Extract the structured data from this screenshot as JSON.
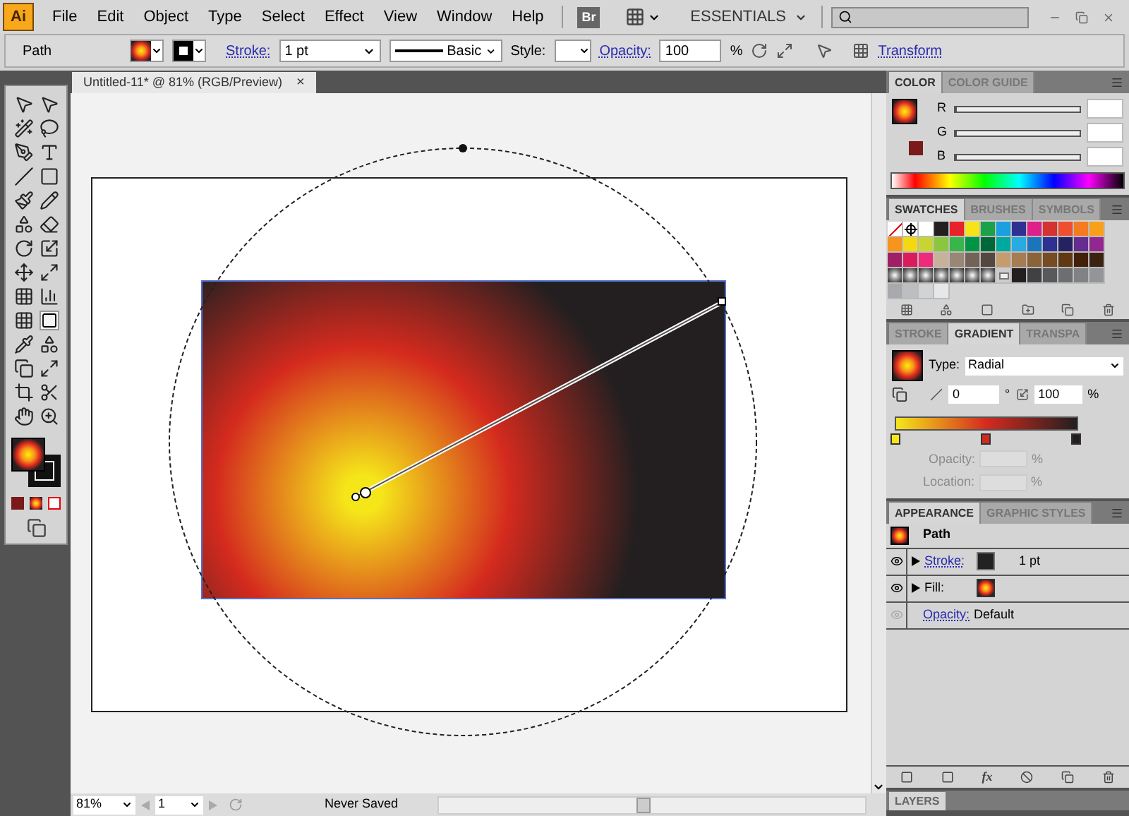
{
  "app_logo": "Ai",
  "menu": [
    "File",
    "Edit",
    "Object",
    "Type",
    "Select",
    "Effect",
    "View",
    "Window",
    "Help"
  ],
  "bridge_button": "Br",
  "workspace": "ESSENTIALS",
  "control_bar": {
    "selection": "Path",
    "stroke_label": "Stroke:",
    "stroke_weight": "1 pt",
    "brush": "Basic",
    "style_label": "Style:",
    "opacity_label": "Opacity:",
    "opacity_value": "100",
    "opacity_unit": "%",
    "transform_link": "Transform"
  },
  "document_tab": {
    "title": "Untitled-11* @ 81% (RGB/Preview)",
    "close": "×"
  },
  "color_panel": {
    "tabs": [
      {
        "label": "COLOR",
        "selected": true
      },
      {
        "label": "COLOR GUIDE",
        "selected": false
      }
    ],
    "channels": [
      {
        "label": "R",
        "level": 0
      },
      {
        "label": "G",
        "level": 0
      },
      {
        "label": "B",
        "level": 0
      }
    ]
  },
  "swatches_panel": {
    "tabs": [
      {
        "label": "SWATCHES",
        "selected": true
      },
      {
        "label": "BRUSHES",
        "selected": false
      },
      {
        "label": "SYMBOLS",
        "selected": false
      }
    ],
    "swatches": [
      {
        "kind": "none"
      },
      {
        "kind": "registration"
      },
      {
        "kind": "solid",
        "color": "#ffffff"
      },
      {
        "kind": "solid",
        "color": "#231f20"
      },
      {
        "kind": "solid",
        "color": "#e8222a"
      },
      {
        "kind": "solid",
        "color": "#f7e417"
      },
      {
        "kind": "solid",
        "color": "#1aa14a"
      },
      {
        "kind": "solid",
        "color": "#1a9fe0"
      },
      {
        "kind": "solid",
        "color": "#2e3192"
      },
      {
        "kind": "solid",
        "color": "#e0208a"
      },
      {
        "kind": "solid",
        "color": "#d4332f"
      },
      {
        "kind": "solid",
        "color": "#ef4e2f"
      },
      {
        "kind": "solid",
        "color": "#f47b20"
      },
      {
        "kind": "solid",
        "color": "#f9a01b"
      },
      {
        "kind": "solid",
        "color": "#f7941d"
      },
      {
        "kind": "solid",
        "color": "#f5d90f"
      },
      {
        "kind": "solid",
        "color": "#c8d531"
      },
      {
        "kind": "solid",
        "color": "#8cc63f"
      },
      {
        "kind": "solid",
        "color": "#39b54a"
      },
      {
        "kind": "solid",
        "color": "#009444"
      },
      {
        "kind": "solid",
        "color": "#006838"
      },
      {
        "kind": "solid",
        "color": "#00a99d"
      },
      {
        "kind": "solid",
        "color": "#29abe2"
      },
      {
        "kind": "solid",
        "color": "#1c75bc"
      },
      {
        "kind": "solid",
        "color": "#2e3192"
      },
      {
        "kind": "solid",
        "color": "#262262"
      },
      {
        "kind": "solid",
        "color": "#662d91"
      },
      {
        "kind": "solid",
        "color": "#92278f"
      },
      {
        "kind": "solid",
        "color": "#9e1f63"
      },
      {
        "kind": "solid",
        "color": "#da1c5c"
      },
      {
        "kind": "solid",
        "color": "#ee2a7b"
      },
      {
        "kind": "solid",
        "color": "#c7b299"
      },
      {
        "kind": "solid",
        "color": "#998675"
      },
      {
        "kind": "solid",
        "color": "#736357"
      },
      {
        "kind": "solid",
        "color": "#534741"
      },
      {
        "kind": "solid",
        "color": "#c69c6d"
      },
      {
        "kind": "solid",
        "color": "#a67c52"
      },
      {
        "kind": "solid",
        "color": "#8c6239"
      },
      {
        "kind": "solid",
        "color": "#754c24"
      },
      {
        "kind": "solid",
        "color": "#603813"
      },
      {
        "kind": "solid",
        "color": "#42210b"
      },
      {
        "kind": "solid",
        "color": "#3b2314"
      },
      {
        "kind": "gradient"
      },
      {
        "kind": "gradient"
      },
      {
        "kind": "gradient"
      },
      {
        "kind": "gradient"
      },
      {
        "kind": "gradient"
      },
      {
        "kind": "gradient"
      },
      {
        "kind": "gradient"
      },
      {
        "kind": "folder"
      },
      {
        "kind": "solid",
        "color": "#231f20"
      },
      {
        "kind": "solid",
        "color": "#414042"
      },
      {
        "kind": "solid",
        "color": "#58595b"
      },
      {
        "kind": "solid",
        "color": "#6d6e71"
      },
      {
        "kind": "solid",
        "color": "#808285"
      },
      {
        "kind": "solid",
        "color": "#939598"
      },
      {
        "kind": "solid",
        "color": "#a7a9ac"
      },
      {
        "kind": "solid",
        "color": "#bcbec0"
      },
      {
        "kind": "solid",
        "color": "#d1d3d4"
      },
      {
        "kind": "solid",
        "color": "#e6e7e8"
      }
    ]
  },
  "gradient_panel": {
    "tabs": [
      {
        "label": "STROKE",
        "selected": false
      },
      {
        "label": "GRADIENT",
        "selected": true
      },
      {
        "label": "TRANSPA",
        "selected": false
      }
    ],
    "type_label": "Type:",
    "type_value": "Radial",
    "angle": "0",
    "degree": "°",
    "aspect": "100",
    "aspect_unit": "%",
    "stops": [
      {
        "color": "#f5e61a",
        "level": 0
      },
      {
        "color": "#d42a1e",
        "level": 0.5
      },
      {
        "color": "#231f20",
        "level": 1
      }
    ],
    "opacity_label": "Opacity:",
    "opacity_unit": "%",
    "location_label": "Location:",
    "location_unit": "%"
  },
  "appearance_panel": {
    "effects_button": "fx",
    "tabs": [
      {
        "label": "APPEARANCE",
        "selected": true
      },
      {
        "label": "GRAPHIC STYLES",
        "selected": false
      }
    ],
    "title": "Path",
    "rows": [
      {
        "kind": "stroke",
        "label": "Stroke:",
        "value": "1 pt",
        "visible": true
      },
      {
        "kind": "fill",
        "label": "Fill:",
        "visible": true
      },
      {
        "kind": "opacity",
        "label": "Opacity:",
        "value": "Default",
        "visible": false
      }
    ]
  },
  "layers_panel": {
    "tab": "LAYERS"
  },
  "status_bar": {
    "zoom": "81%",
    "page": "1",
    "status": "Never Saved"
  }
}
